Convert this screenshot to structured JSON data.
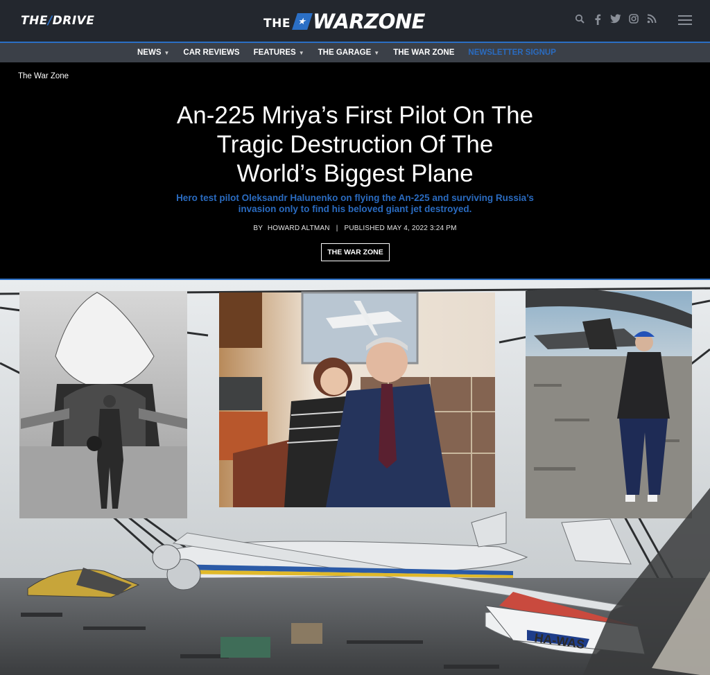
{
  "header": {
    "left_logo": {
      "prefix": "THE",
      "slash": "/",
      "name": "DRIVE"
    },
    "center_logo": {
      "prefix": "THE",
      "star": "★",
      "name": "WARZONE"
    },
    "icons": [
      "search-icon",
      "facebook-icon",
      "twitter-icon",
      "instagram-icon",
      "rss-icon",
      "menu-icon"
    ]
  },
  "nav": {
    "items": [
      {
        "label": "NEWS",
        "dropdown": true
      },
      {
        "label": "CAR REVIEWS",
        "dropdown": false
      },
      {
        "label": "FEATURES",
        "dropdown": true
      },
      {
        "label": "THE GARAGE",
        "dropdown": true
      },
      {
        "label": "THE WAR ZONE",
        "dropdown": false
      },
      {
        "label": "NEWSLETTER SIGNUP",
        "dropdown": false
      }
    ]
  },
  "article": {
    "breadcrumb": "The War Zone",
    "title_lines": [
      "An-225 Mriya’s First Pilot On The",
      "Tragic Destruction Of The",
      "World’s Biggest Plane"
    ],
    "dek_lines": [
      "Hero test pilot Oleksandr Halunenko on flying the An-225 and surviving Russia’s",
      "invasion only to find his beloved giant jet destroyed."
    ],
    "by_label": "BY",
    "author": "HOWARD ALTMAN",
    "divider": "|",
    "published": "PUBLISHED MAY 4, 2022 3:24 PM",
    "section_button": "THE WAR ZONE",
    "image": {
      "wreck_registration": "HA-WAS"
    }
  },
  "colors": {
    "accent": "#2b6fc5",
    "header_bg": "#23272e",
    "nav_bg": "#3b4048"
  }
}
